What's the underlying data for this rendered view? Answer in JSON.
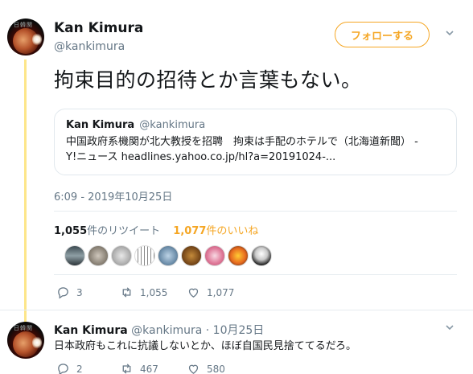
{
  "tweet": {
    "author_name": "Kan Kimura",
    "author_handle": "@kankimura",
    "avatar_tag": "日韓関",
    "follow_label": "フォローする",
    "text": "拘束目的の招待とか言葉もない。",
    "quote": {
      "name": "Kan Kimura",
      "handle": "@kankimura",
      "line1": "中国政府系機関が北大教授を招聘　拘束は手配のホテルで（北海道新聞） -",
      "line2": "Y!ニュース  headlines.yahoo.co.jp/hl?a=20191024-..."
    },
    "timestamp": "6:09 - 2019年10月25日",
    "retweets_count": "1,055",
    "retweets_label": "件のリツイート",
    "likes_count": "1,077",
    "likes_label": "件のいいね",
    "actions": {
      "replies": "3",
      "retweets": "1,055",
      "likes": "1,077"
    }
  },
  "reply": {
    "author_name": "Kan Kimura",
    "author_handle": "@kankimura",
    "separator": "·",
    "date": "10月25日",
    "text": "日本政府もこれに抗議しないとか、ほぼ自国民見捨ててるだろ。",
    "actions": {
      "replies": "2",
      "retweets": "467",
      "likes": "580"
    }
  },
  "colors": {
    "accent": "#f5a623",
    "muted": "#657786",
    "text": "#14171a",
    "border": "#e1e8ed"
  },
  "icons": [
    "reply-icon",
    "retweet-icon",
    "heart-icon",
    "chevron-down-icon"
  ]
}
